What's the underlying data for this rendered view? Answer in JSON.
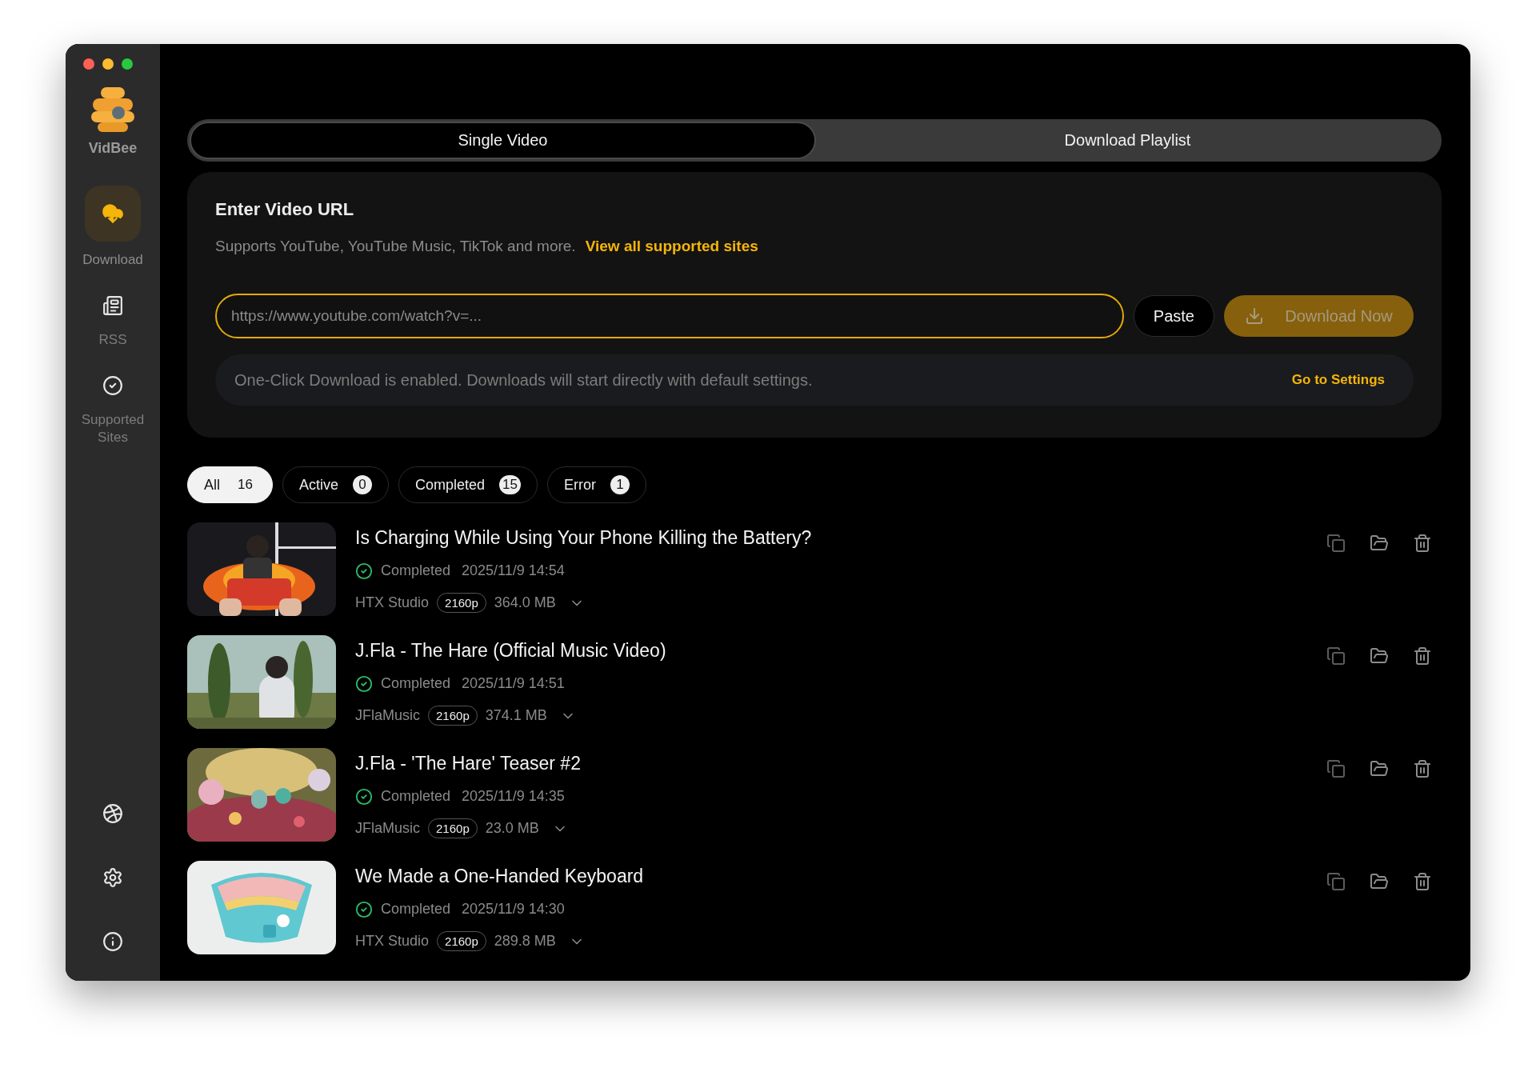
{
  "app": {
    "name": "VidBee"
  },
  "sidebar": {
    "items": [
      {
        "label": "Download",
        "kind": "download",
        "selected": true
      },
      {
        "label": "RSS",
        "kind": "rss",
        "selected": false
      },
      {
        "label": "Supported Sites",
        "kind": "sites",
        "selected": false
      }
    ]
  },
  "tabs": [
    {
      "label": "Single Video",
      "selected": true
    },
    {
      "label": "Download Playlist",
      "selected": false
    }
  ],
  "url_card": {
    "heading": "Enter Video URL",
    "description": "Supports YouTube, YouTube Music, TikTok and more.",
    "link": "View all supported sites",
    "url_field": {
      "placeholder": "https://www.youtube.com/watch?v=..."
    },
    "paste_button": "Paste",
    "download_button": {
      "label": "Download Now",
      "disabled": true
    },
    "notice": {
      "text": "One-Click Download is enabled. Downloads will start directly with default settings.",
      "link": "Go to Settings"
    }
  },
  "filters": [
    {
      "label": "All",
      "count": "16",
      "selected": true
    },
    {
      "label": "Active",
      "count": "0",
      "selected": false
    },
    {
      "label": "Completed",
      "count": "15",
      "selected": false
    },
    {
      "label": "Error",
      "count": "1",
      "selected": false
    }
  ],
  "downloads": [
    {
      "title": "Is Charging While Using Your Phone Killing the Battery?",
      "status": "Completed",
      "time": "2025/11/9 14:54",
      "channel": "HTX Studio",
      "quality": "2160p",
      "size": "364.0 MB"
    },
    {
      "title": "J.Fla - The Hare (Official Music Video)",
      "status": "Completed",
      "time": "2025/11/9 14:51",
      "channel": "JFlaMusic",
      "quality": "2160p",
      "size": "374.1 MB"
    },
    {
      "title": "J.Fla - 'The Hare' Teaser #2",
      "status": "Completed",
      "time": "2025/11/9 14:35",
      "channel": "JFlaMusic",
      "quality": "2160p",
      "size": "23.0 MB"
    },
    {
      "title": "We Made a One-Handed Keyboard",
      "status": "Completed",
      "time": "2025/11/9 14:30",
      "channel": "HTX Studio",
      "quality": "2160p",
      "size": "289.8 MB"
    }
  ]
}
